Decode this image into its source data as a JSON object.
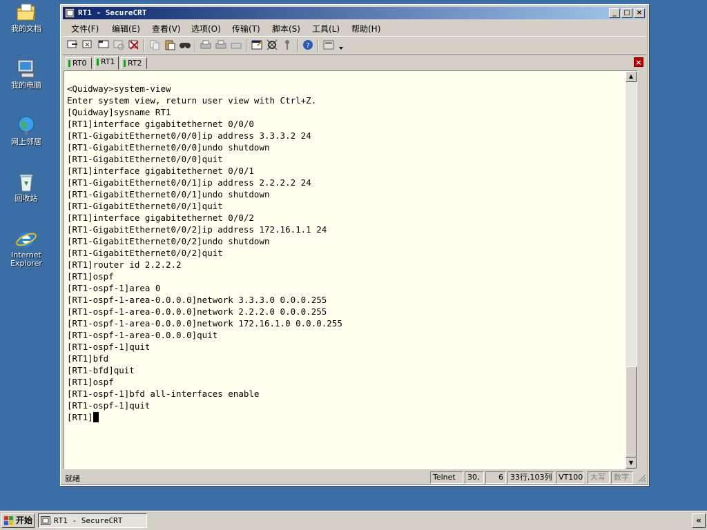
{
  "desktop": {
    "icons": [
      {
        "label": "我的文档",
        "icon": "my-documents-icon"
      },
      {
        "label": "我的电脑",
        "icon": "my-computer-icon"
      },
      {
        "label": "网上邻居",
        "icon": "network-places-icon"
      },
      {
        "label": "回收站",
        "icon": "recycle-bin-icon"
      },
      {
        "label": "Internet\nExplorer",
        "icon": "internet-explorer-icon"
      }
    ]
  },
  "window": {
    "title": "RT1 - SecureCRT",
    "controls": {
      "minimize": "_",
      "maximize": "□",
      "close": "×"
    },
    "menu": [
      "文件(F)",
      "编辑(E)",
      "查看(V)",
      "选项(O)",
      "传输(T)",
      "脚本(S)",
      "工具(L)",
      "帮助(H)"
    ],
    "tabs": [
      {
        "label": "RT0",
        "active": false
      },
      {
        "label": "RT1",
        "active": true
      },
      {
        "label": "RT2",
        "active": false
      }
    ],
    "tab_close": "×",
    "terminal": {
      "lines": [
        "<Quidway>system-view",
        "Enter system view, return user view with Ctrl+Z.",
        "[Quidway]sysname RT1",
        "[RT1]interface gigabitethernet 0/0/0",
        "[RT1-GigabitEthernet0/0/0]ip address 3.3.3.2 24",
        "[RT1-GigabitEthernet0/0/0]undo shutdown",
        "[RT1-GigabitEthernet0/0/0]quit",
        "[RT1]interface gigabitethernet 0/0/1",
        "[RT1-GigabitEthernet0/0/1]ip address 2.2.2.2 24",
        "[RT1-GigabitEthernet0/0/1]undo shutdown",
        "[RT1-GigabitEthernet0/0/1]quit",
        "[RT1]interface gigabitethernet 0/0/2",
        "[RT1-GigabitEthernet0/0/2]ip address 172.16.1.1 24",
        "[RT1-GigabitEthernet0/0/2]undo shutdown",
        "[RT1-GigabitEthernet0/0/2]quit",
        "[RT1]router id 2.2.2.2",
        "[RT1]ospf",
        "[RT1-ospf-1]area 0",
        "[RT1-ospf-1-area-0.0.0.0]network 3.3.3.0 0.0.0.255",
        "[RT1-ospf-1-area-0.0.0.0]network 2.2.2.0 0.0.0.255",
        "[RT1-ospf-1-area-0.0.0.0]network 172.16.1.0 0.0.0.255",
        "[RT1-ospf-1-area-0.0.0.0]quit",
        "[RT1-ospf-1]quit",
        "[RT1]bfd",
        "[RT1-bfd]quit",
        "[RT1]ospf",
        "[RT1-ospf-1]bfd all-interfaces enable",
        "[RT1-ospf-1]quit"
      ],
      "prompt": "[RT1]"
    },
    "status": {
      "ready": "就绪",
      "protocol": "Telnet",
      "row": "30,",
      "col": "6",
      "size": "33行,103列",
      "emulation": "VT100",
      "caps": "大写",
      "num": "数字"
    }
  },
  "taskbar": {
    "start": "开始",
    "task": "RT1 - SecureCRT",
    "tray_toggle": "«"
  }
}
